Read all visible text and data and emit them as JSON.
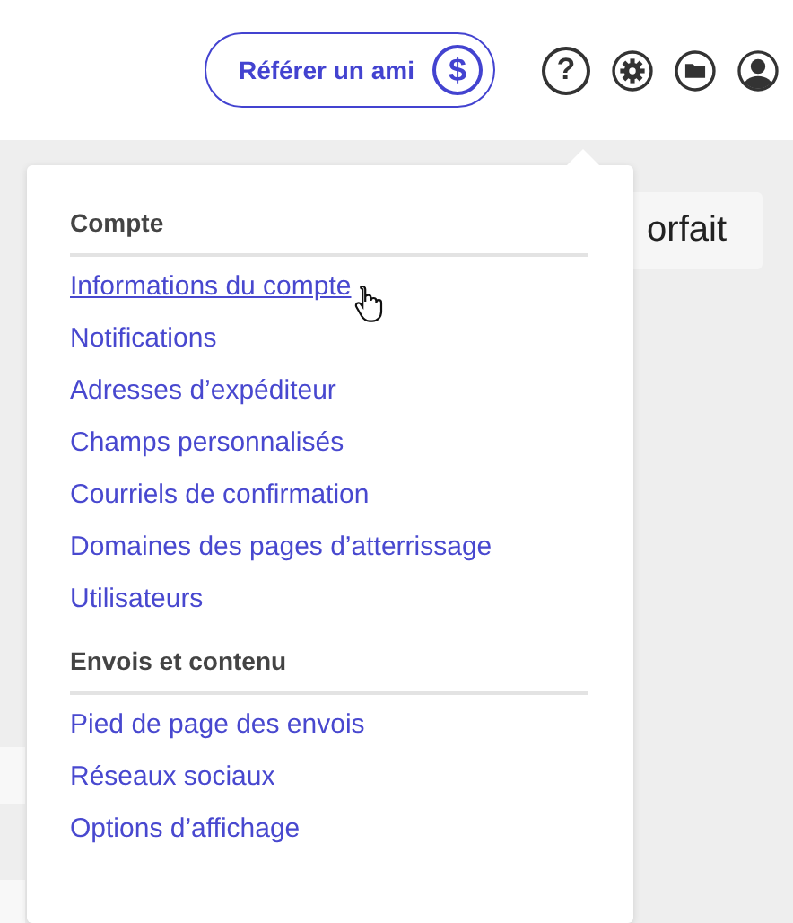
{
  "header": {
    "refer_button": {
      "label": "Référer un ami",
      "symbol": "$"
    },
    "help_symbol": "?"
  },
  "background_card": {
    "label": "orfait"
  },
  "menu": {
    "sections": [
      {
        "title": "Compte",
        "items": [
          {
            "label": "Informations du compte",
            "hovered": true
          },
          {
            "label": "Notifications",
            "hovered": false
          },
          {
            "label": "Adresses d’expéditeur",
            "hovered": false
          },
          {
            "label": "Champs personnalisés",
            "hovered": false
          },
          {
            "label": "Courriels de confirmation",
            "hovered": false
          },
          {
            "label": "Domaines des pages d’atterrissage",
            "hovered": false
          },
          {
            "label": "Utilisateurs",
            "hovered": false
          }
        ]
      },
      {
        "title": "Envois et contenu",
        "items": [
          {
            "label": "Pied de page des envois",
            "hovered": false
          },
          {
            "label": "Réseaux sociaux",
            "hovered": false
          },
          {
            "label": "Options d’affichage",
            "hovered": false
          }
        ]
      }
    ]
  }
}
